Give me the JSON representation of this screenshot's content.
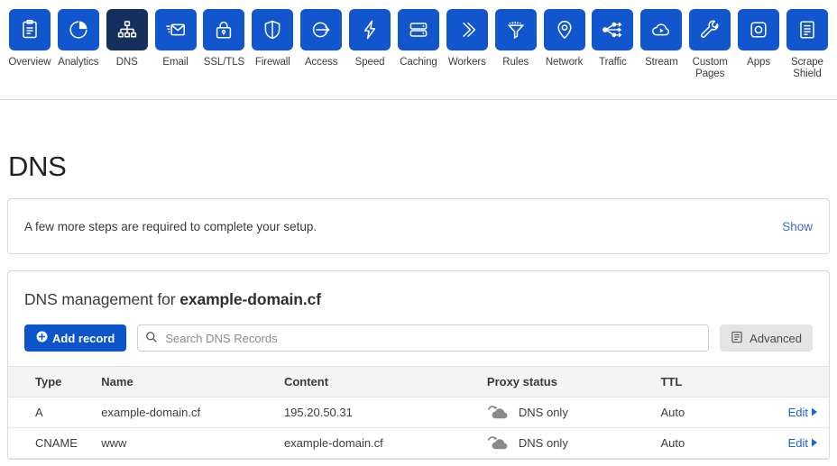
{
  "nav": {
    "items": [
      {
        "label": "Overview",
        "icon": "clipboard-icon",
        "active": false
      },
      {
        "label": "Analytics",
        "icon": "pie-chart-icon",
        "active": false
      },
      {
        "label": "DNS",
        "icon": "sitemap-icon",
        "active": true
      },
      {
        "label": "Email",
        "icon": "envelope-icon",
        "active": false
      },
      {
        "label": "SSL/TLS",
        "icon": "lock-icon",
        "active": false
      },
      {
        "label": "Firewall",
        "icon": "shield-icon",
        "active": false
      },
      {
        "label": "Access",
        "icon": "sign-in-icon",
        "active": false
      },
      {
        "label": "Speed",
        "icon": "bolt-icon",
        "active": false
      },
      {
        "label": "Caching",
        "icon": "server-icon",
        "active": false
      },
      {
        "label": "Workers",
        "icon": "chevrons-icon",
        "active": false
      },
      {
        "label": "Rules",
        "icon": "funnel-icon",
        "active": false
      },
      {
        "label": "Network",
        "icon": "map-pin-icon",
        "active": false
      },
      {
        "label": "Traffic",
        "icon": "share-nodes-icon",
        "active": false
      },
      {
        "label": "Stream",
        "icon": "cloud-play-icon",
        "active": false
      },
      {
        "label": "Custom Pages",
        "icon": "wrench-icon",
        "active": false
      },
      {
        "label": "Apps",
        "icon": "apps-icon",
        "active": false
      },
      {
        "label": "Scrape Shield",
        "icon": "document-icon",
        "active": false
      }
    ],
    "active_tile_color": "#16305e",
    "tile_color": "#1156cc"
  },
  "page": {
    "title": "DNS"
  },
  "notice": {
    "text": "A few more steps are required to complete your setup.",
    "link_label": "Show",
    "link_color": "#4169c9"
  },
  "dns": {
    "heading_prefix": "DNS management for ",
    "domain": "example-domain.cf",
    "add_record_label": "Add record",
    "search_placeholder": "Search DNS Records",
    "search_value": "",
    "advanced_label": "Advanced",
    "columns": [
      "Type",
      "Name",
      "Content",
      "Proxy status",
      "TTL",
      ""
    ],
    "edit_label": "Edit",
    "rows": [
      {
        "type": "A",
        "name": "example-domain.cf",
        "content": "195.20.50.31",
        "proxy_status": "DNS only",
        "proxy_icon": "grey-cloud-icon",
        "ttl": "Auto",
        "edit": "Edit"
      },
      {
        "type": "CNAME",
        "name": "www",
        "content": "example-domain.cf",
        "proxy_status": "DNS only",
        "proxy_icon": "grey-cloud-icon",
        "ttl": "Auto",
        "edit": "Edit"
      }
    ]
  },
  "colors": {
    "brand_blue": "#1156cc",
    "active_navy": "#16305e",
    "link_blue": "#1463d8",
    "proxy_grey": "#878787"
  }
}
